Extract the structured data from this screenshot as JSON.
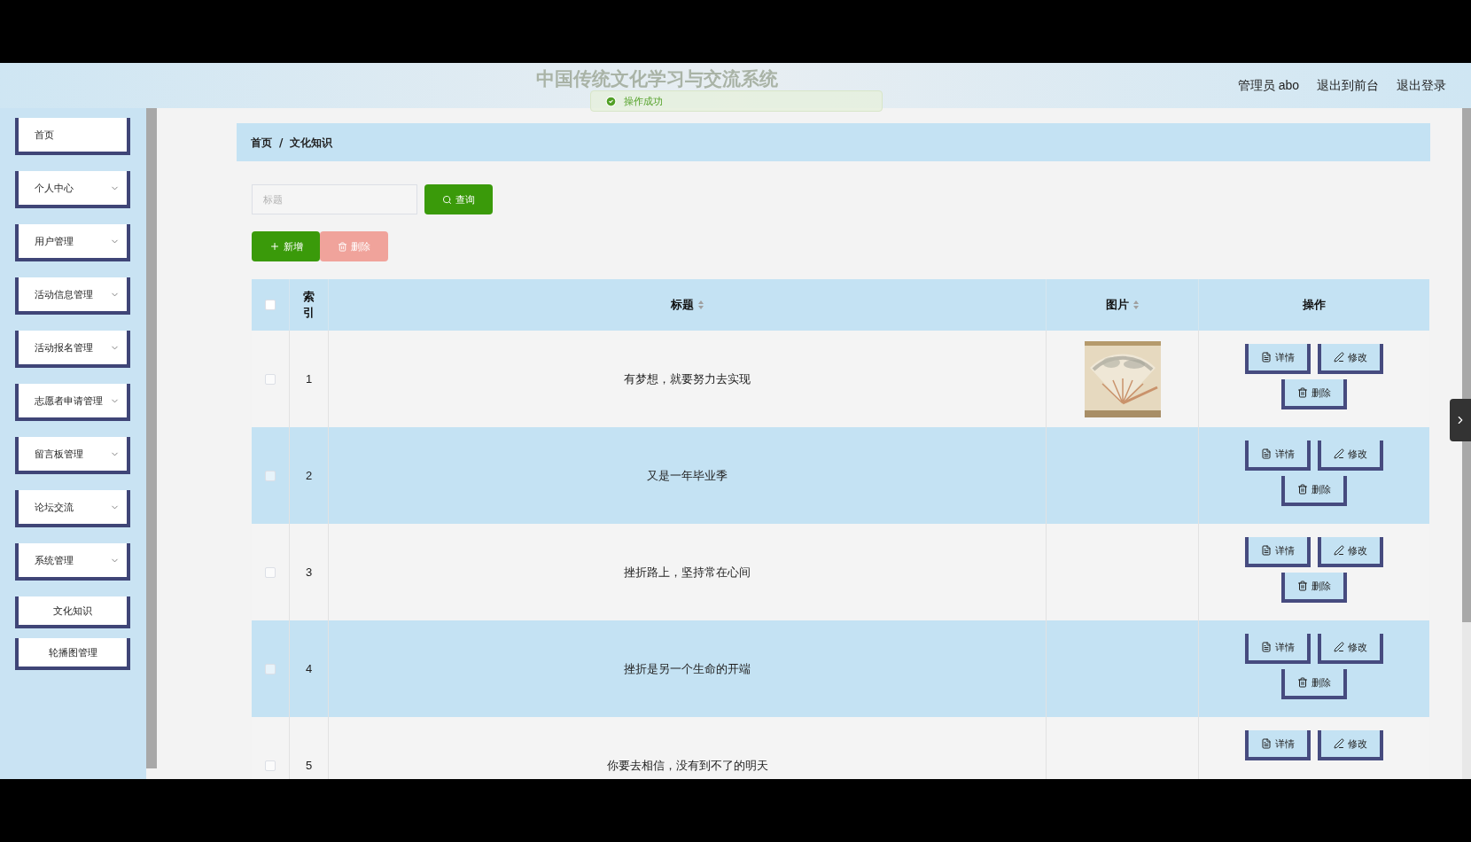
{
  "header": {
    "title": "中国传统文化学习与交流系统",
    "toast": "操作成功",
    "user": "管理员 abo",
    "links": [
      "退出到前台",
      "退出登录"
    ]
  },
  "sidebar": {
    "items": [
      {
        "label": "首页",
        "kind": "link",
        "expandable": false
      },
      {
        "label": "个人中心",
        "kind": "menu",
        "expandable": true
      },
      {
        "label": "用户管理",
        "kind": "menu",
        "expandable": true
      },
      {
        "label": "活动信息管理",
        "kind": "menu",
        "expandable": true
      },
      {
        "label": "活动报名管理",
        "kind": "menu",
        "expandable": true
      },
      {
        "label": "志愿者申请管理",
        "kind": "menu",
        "expandable": true
      },
      {
        "label": "留言板管理",
        "kind": "menu",
        "expandable": true
      },
      {
        "label": "论坛交流",
        "kind": "menu",
        "expandable": true
      },
      {
        "label": "系统管理",
        "kind": "menu",
        "expandable": true
      },
      {
        "label": "文化知识",
        "kind": "sub",
        "expandable": false
      },
      {
        "label": "轮播图管理",
        "kind": "sub",
        "expandable": false
      }
    ]
  },
  "breadcrumb": [
    "首页",
    "文化知识"
  ],
  "breadcrumb_separator": "/",
  "search": {
    "placeholder": "标题",
    "button": "查询"
  },
  "toolbar": [
    {
      "label": "新增",
      "kind": "add",
      "disabled": false
    },
    {
      "label": "删除",
      "kind": "delete",
      "disabled": true
    }
  ],
  "table": {
    "select_all": {
      "checked": false
    },
    "columns": [
      "索引",
      "标题",
      "图片",
      "操作"
    ],
    "rows": [
      {
        "checked": false,
        "index": "1",
        "title": "有梦想，就要努力去实现",
        "has_picture": true,
        "actions": [
          "详情",
          "修改",
          "删除"
        ]
      },
      {
        "checked": false,
        "index": "2",
        "title": "又是一年毕业季",
        "has_picture": false,
        "actions": [
          "详情",
          "修改",
          "删除"
        ]
      },
      {
        "checked": false,
        "index": "3",
        "title": "挫折路上，坚持常在心间",
        "has_picture": false,
        "actions": [
          "详情",
          "修改",
          "删除"
        ]
      },
      {
        "checked": false,
        "index": "4",
        "title": "挫折是另一个生命的开端",
        "has_picture": false,
        "actions": [
          "详情",
          "修改",
          "删除"
        ]
      },
      {
        "checked": false,
        "index": "5",
        "title": "你要去相信，没有到不了的明天",
        "has_picture": false,
        "actions": [
          "详情",
          "修改"
        ]
      }
    ]
  }
}
